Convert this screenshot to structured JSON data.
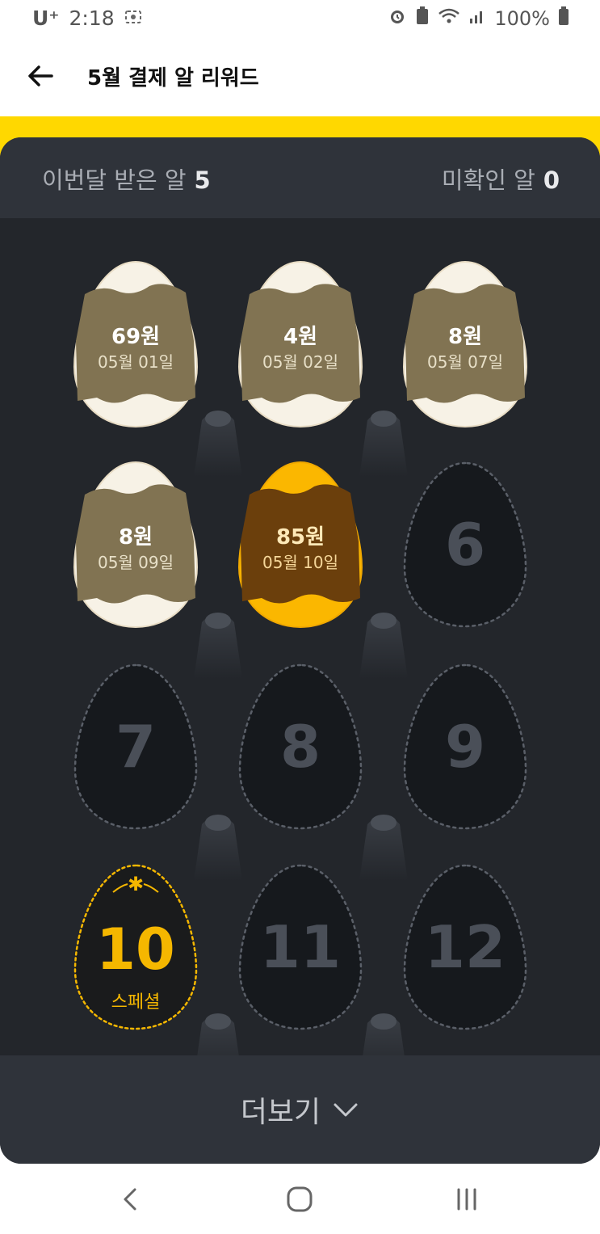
{
  "status": {
    "carrier": "U⁺",
    "time": "2:18",
    "battery": "100%"
  },
  "header": {
    "title": "5월 결제 알 리워드"
  },
  "summary": {
    "received_label": "이번달 받은 알",
    "received_value": "5",
    "unconfirmed_label": "미확인 알",
    "unconfirmed_value": "0"
  },
  "eggs": [
    {
      "amount": "69원",
      "date": "05월 01일",
      "state": "opened"
    },
    {
      "amount": "4원",
      "date": "05월 02일",
      "state": "opened"
    },
    {
      "amount": "8원",
      "date": "05월 07일",
      "state": "opened"
    },
    {
      "amount": "8원",
      "date": "05월 09일",
      "state": "opened"
    },
    {
      "amount": "85원",
      "date": "05월 10일",
      "state": "opened-gold"
    },
    {
      "number": "6",
      "state": "locked"
    },
    {
      "number": "7",
      "state": "locked"
    },
    {
      "number": "8",
      "state": "locked"
    },
    {
      "number": "9",
      "state": "locked"
    },
    {
      "number": "10",
      "label": "스페셜",
      "state": "special"
    },
    {
      "number": "11",
      "state": "locked"
    },
    {
      "number": "12",
      "state": "locked"
    }
  ],
  "more": {
    "label": "더보기"
  },
  "icons": {
    "back": "arrow-left-icon",
    "chevron": "chevron-down-icon",
    "nav_back": "nav-back-icon",
    "nav_home": "nav-home-icon",
    "nav_recent": "nav-recent-icon"
  },
  "colors": {
    "accent": "#ffd800",
    "gold": "#f5b700",
    "card": "#23262b"
  }
}
